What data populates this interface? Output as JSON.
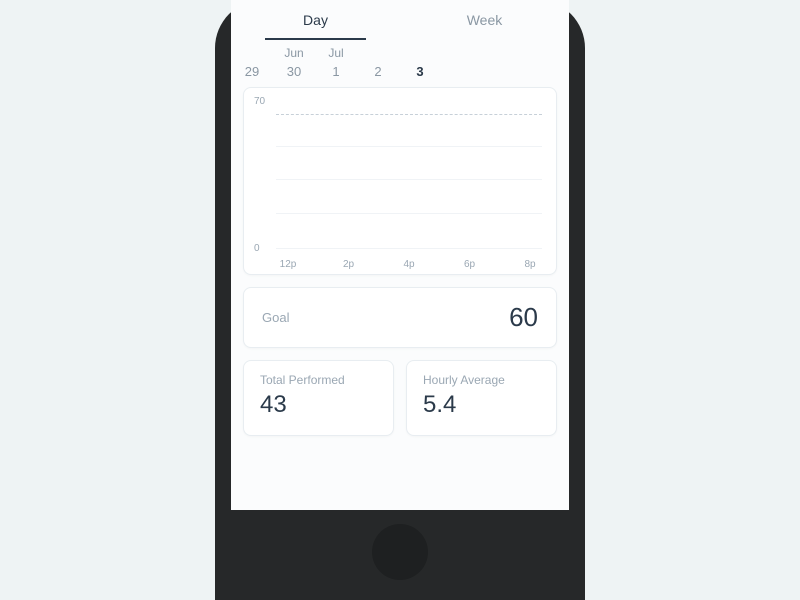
{
  "tabs": {
    "day": "Day",
    "week": "Week"
  },
  "calendar": {
    "months": [
      "",
      "Jun",
      "Jul",
      "",
      ""
    ],
    "days": [
      "29",
      "30",
      "1",
      "2",
      "3"
    ],
    "selected_index": 4
  },
  "chart_data": {
    "type": "line",
    "x_ticks": [
      "12p",
      "2p",
      "4p",
      "6p",
      "8p"
    ],
    "y_top": "70",
    "y_bottom": "0",
    "ylim": [
      0,
      70
    ],
    "goal_line": 65,
    "series": [],
    "title": "",
    "xlabel": "",
    "ylabel": ""
  },
  "goal": {
    "label": "Goal",
    "value": "60"
  },
  "stats": {
    "total": {
      "label": "Total Performed",
      "value": "43"
    },
    "avg": {
      "label": "Hourly Average",
      "value": "5.4"
    }
  }
}
